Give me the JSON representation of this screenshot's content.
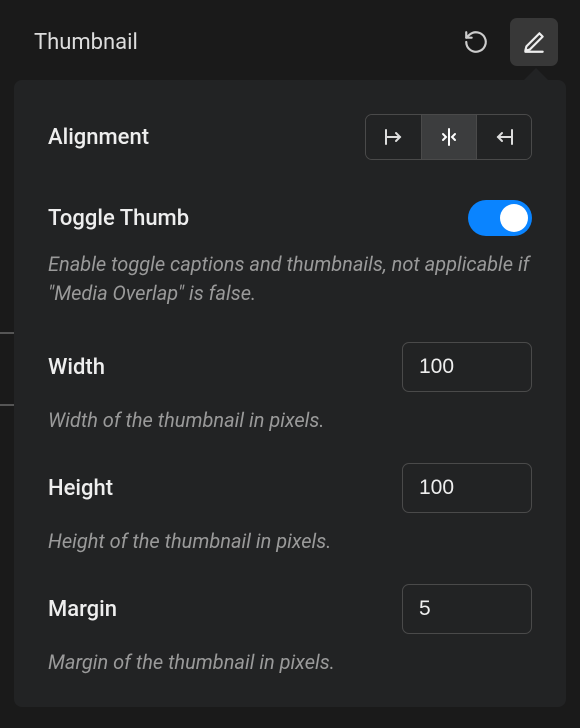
{
  "header": {
    "title": "Thumbnail",
    "resetIcon": "reset-icon",
    "editIcon": "pencil-icon"
  },
  "alignment": {
    "label": "Alignment",
    "options": [
      "left",
      "center",
      "right"
    ],
    "selected": "center"
  },
  "toggleThumb": {
    "label": "Toggle Thumb",
    "value": true,
    "helper": "Enable toggle captions and thumbnails, not applicable if \"Media Overlap\" is false."
  },
  "width": {
    "label": "Width",
    "value": "100",
    "helper": "Width of the thumbnail in pixels."
  },
  "height": {
    "label": "Height",
    "value": "100",
    "helper": "Height of the thumbnail in pixels."
  },
  "margin": {
    "label": "Margin",
    "value": "5",
    "helper": "Margin of the thumbnail in pixels."
  }
}
